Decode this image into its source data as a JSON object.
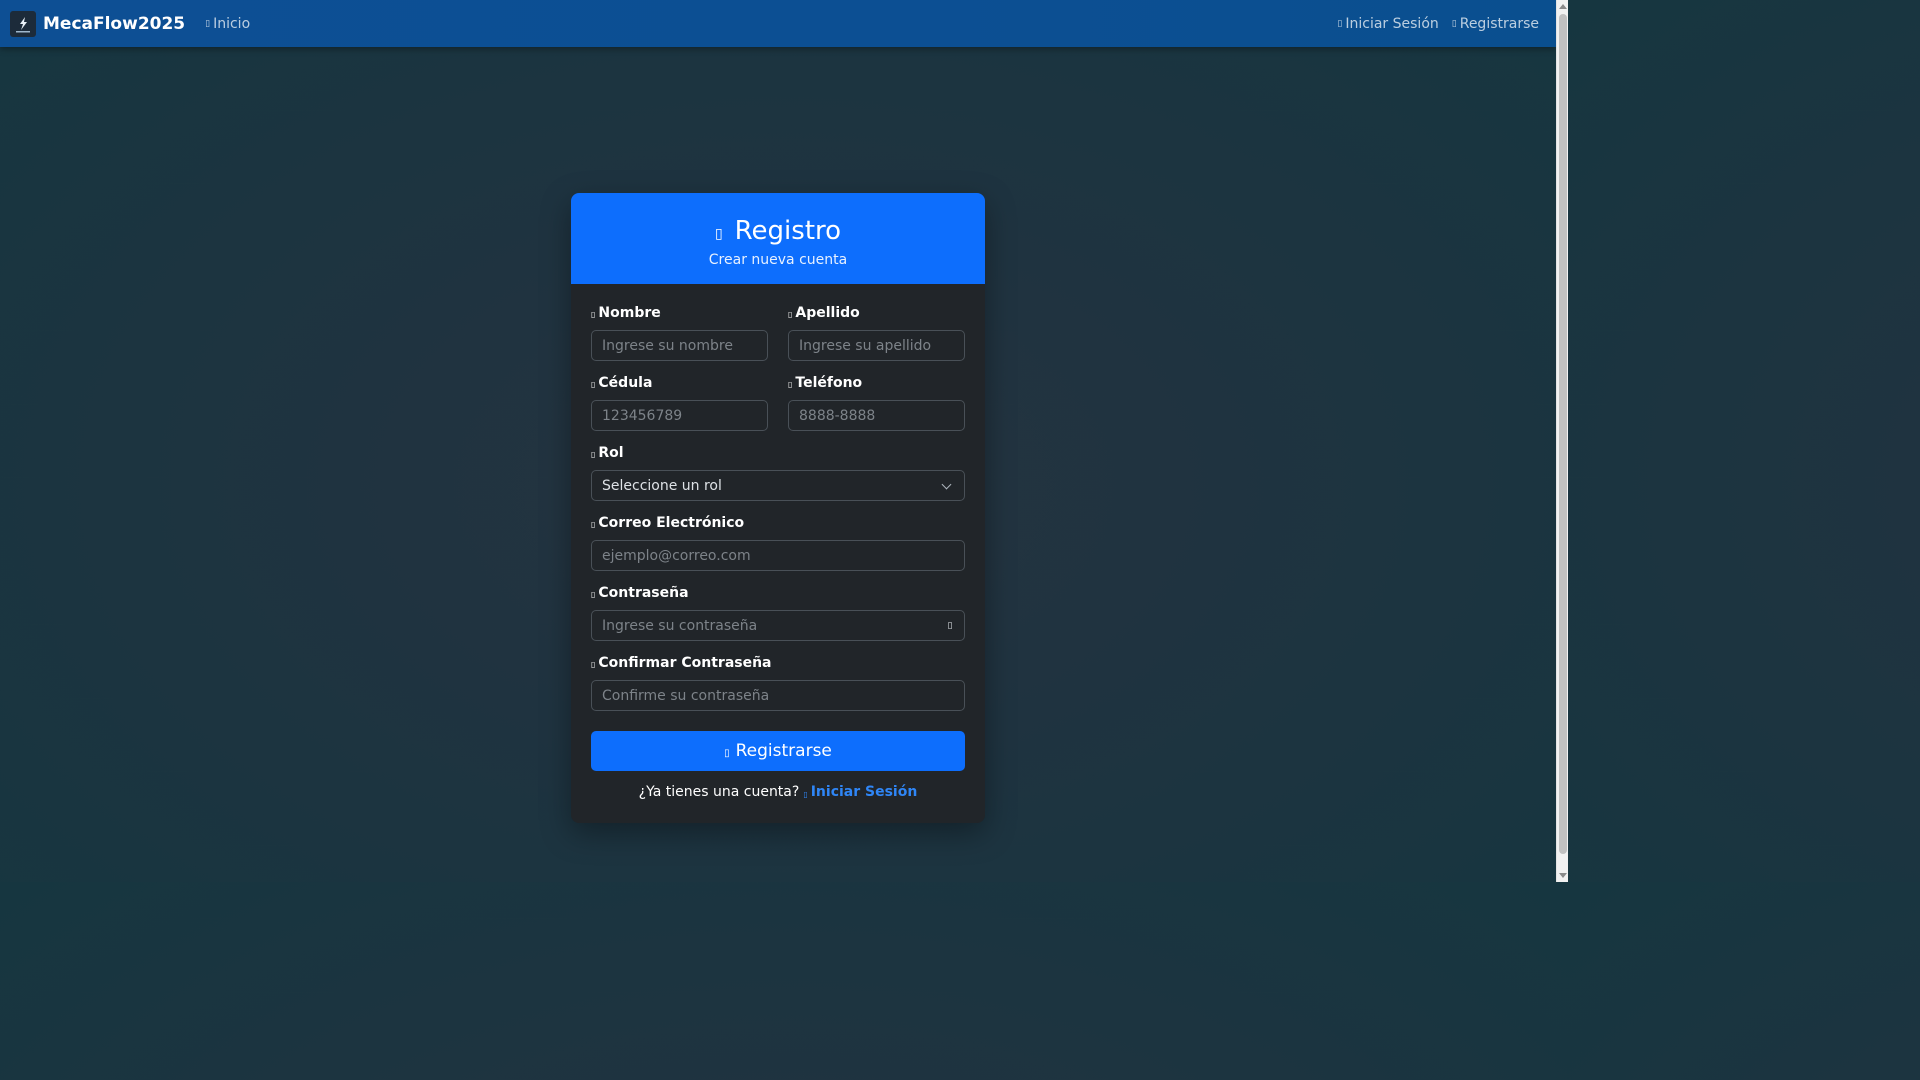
{
  "navbar": {
    "brand": "MecaFlow2025",
    "logo_icon": "wrench-flow-logo",
    "links_left": [
      {
        "label": "Inicio",
        "icon": "house-icon"
      }
    ],
    "links_right": [
      {
        "label": "Iniciar Sesión",
        "icon": "login-icon"
      },
      {
        "label": "Registrarse",
        "icon": "user-plus-icon"
      }
    ]
  },
  "card": {
    "title": "Registro",
    "title_icon": "user-plus-icon",
    "subtitle": "Crear nueva cuenta",
    "fields": {
      "nombre": {
        "label": "Nombre",
        "placeholder": "Ingrese su nombre",
        "value": ""
      },
      "apellido": {
        "label": "Apellido",
        "placeholder": "Ingrese su apellido",
        "value": ""
      },
      "cedula": {
        "label": "Cédula",
        "placeholder": "123456789",
        "value": ""
      },
      "telefono": {
        "label": "Teléfono",
        "placeholder": "8888-8888",
        "value": ""
      },
      "rol": {
        "label": "Rol",
        "selected": "Seleccione un rol"
      },
      "correo": {
        "label": "Correo Electrónico",
        "placeholder": "ejemplo@correo.com",
        "value": ""
      },
      "contrasena": {
        "label": "Contraseña",
        "placeholder": "Ingrese su contraseña",
        "value": ""
      },
      "confirmar": {
        "label": "Confirmar Contraseña",
        "placeholder": "Confirme su contraseña",
        "value": ""
      }
    },
    "submit_label": "Registrarse",
    "footer_text": "¿Ya tienes una cuenta?",
    "footer_link": "Iniciar Sesión"
  },
  "colors": {
    "primary": "#0d6efd",
    "navbar": "#0c4f93",
    "card_body": "#212529",
    "link": "#2f86f6"
  }
}
